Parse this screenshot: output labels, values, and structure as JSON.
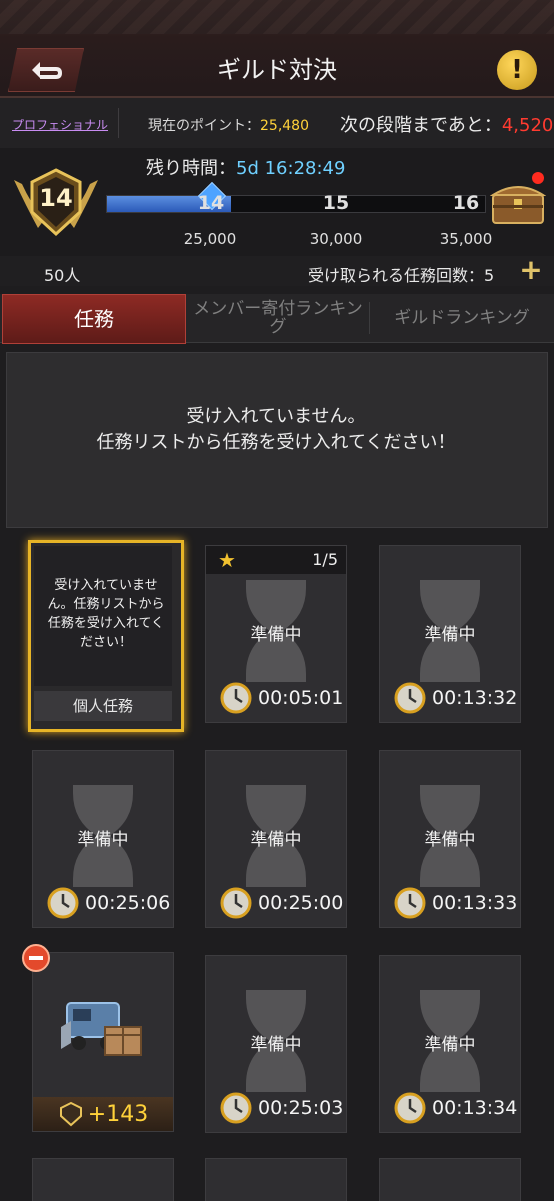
{
  "header": {
    "title": "ギルド対決"
  },
  "info": {
    "rank": "プロフェショナル",
    "points_label": "現在のポイント：",
    "points_value": "25,480",
    "next_label": "次の段階まであと：",
    "next_value": "4,520"
  },
  "progress": {
    "time_label": "残り時間：",
    "time_value": "5d 16:28:49",
    "level": "14",
    "levels": [
      "14",
      "15",
      "16"
    ],
    "thresholds": [
      "25,000",
      "30,000",
      "35,000"
    ],
    "fill_fraction": 0.33
  },
  "counts": {
    "members": "50人",
    "claims": "受け取られる任務回数：5"
  },
  "tabs": [
    {
      "label": "任務",
      "active": true
    },
    {
      "label": "メンバー寄付ランキング",
      "active": false
    },
    {
      "label": "ギルドランキング",
      "active": false
    }
  ],
  "message": {
    "line1": "受け入れていません。",
    "line2": "任務リストから任務を受け入れてください！"
  },
  "personal_card": {
    "text": "受け入れていません。任務リストから任務を受け入れてください！",
    "label": "個人任務"
  },
  "tasks": [
    {
      "status": "準備中",
      "timer": "00:05:01",
      "star": true,
      "count": "1/5"
    },
    {
      "status": "準備中",
      "timer": "00:13:32"
    },
    {
      "status": "準備中",
      "timer": "00:25:06"
    },
    {
      "status": "準備中",
      "timer": "00:25:00"
    },
    {
      "status": "準備中",
      "timer": "00:13:33"
    },
    {
      "status": "準備中",
      "timer": "00:25:03"
    },
    {
      "status": "準備中",
      "timer": "00:13:34"
    }
  ],
  "reward": {
    "value": "+143"
  },
  "colors": {
    "accent_red": "#ff3b30",
    "gold": "#ffd23a",
    "cyan": "#6fd0ff",
    "bar_blue": "#2b5ab8"
  }
}
